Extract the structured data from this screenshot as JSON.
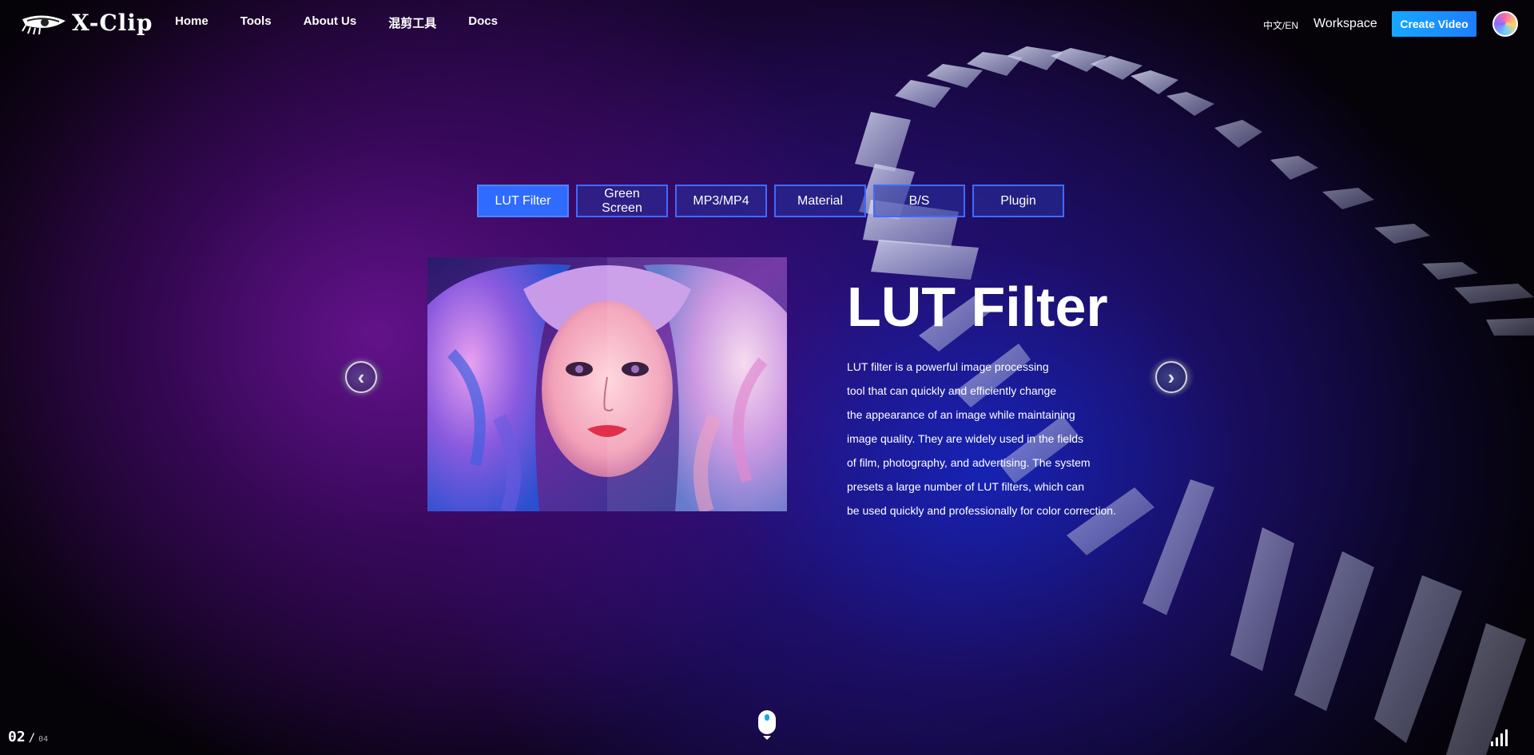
{
  "header": {
    "logo_text": "X-Clip",
    "nav": [
      {
        "label": "Home"
      },
      {
        "label": "Tools"
      },
      {
        "label": "About Us"
      },
      {
        "label": "混剪工具"
      },
      {
        "label": "Docs"
      }
    ],
    "lang_toggle": "中文/EN",
    "workspace_label": "Workspace",
    "create_button": "Create Video",
    "avatar_icon": "user-avatar"
  },
  "tabs": [
    {
      "label": "LUT Filter",
      "active": true
    },
    {
      "label": "Green Screen",
      "active": false
    },
    {
      "label": "MP3/MP4",
      "active": false
    },
    {
      "label": "Material",
      "active": false
    },
    {
      "label": "B/S",
      "active": false
    },
    {
      "label": "Plugin",
      "active": false
    }
  ],
  "feature": {
    "title": "LUT Filter",
    "description_lines": [
      "LUT filter is a powerful image processing",
      "tool that can quickly and efficiently change",
      "the appearance of an image while maintaining",
      "image quality. They are widely used in the fields",
      "of film, photography, and advertising. The system",
      "presets a large number of LUT filters, which can",
      "be used quickly and professionally for color correction."
    ],
    "image_icon": "portrait-illustration"
  },
  "carousel": {
    "prev_icon": "chevron-left-icon",
    "next_icon": "chevron-right-icon"
  },
  "pager": {
    "current": "02",
    "separator": "/",
    "total": "04"
  },
  "colors": {
    "accent": "#2f6bff",
    "create_button": "#1d7dff",
    "scroll_dot": "#1aa7e6"
  }
}
